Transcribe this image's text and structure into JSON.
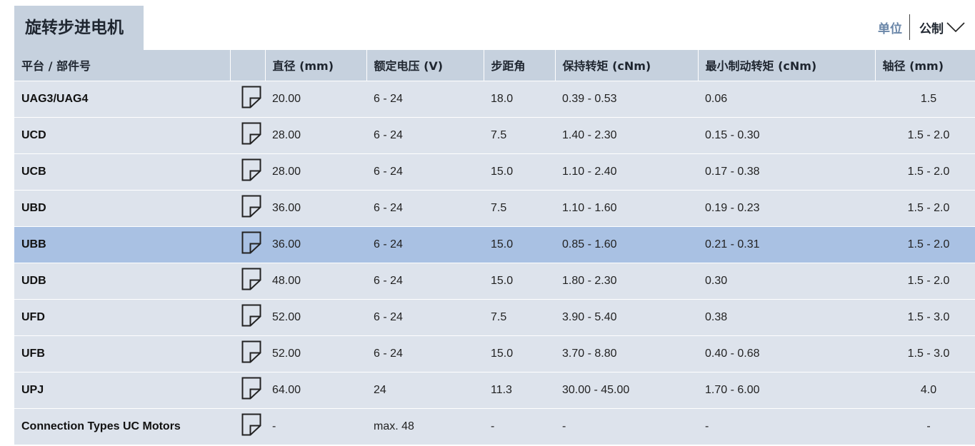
{
  "header": {
    "title": "旋转步进电机",
    "units_label": "单位",
    "units_value": "公制"
  },
  "table": {
    "columns": [
      "平台 / 部件号",
      "",
      "直径 (mm)",
      "额定电压 (V)",
      "步距角",
      "保持转矩 (cNm)",
      "最小制动转矩 (cNm)",
      "轴径 (mm)"
    ],
    "rows": [
      {
        "part": "UAG3/UAG4",
        "diameter": "20.00",
        "voltage": "6 - 24",
        "step_angle": "18.0",
        "holding_torque": "0.39 - 0.53",
        "detent_torque": "0.06",
        "shaft": "1.5"
      },
      {
        "part": "UCD",
        "diameter": "28.00",
        "voltage": "6 - 24",
        "step_angle": "7.5",
        "holding_torque": "1.40 - 2.30",
        "detent_torque": "0.15 - 0.30",
        "shaft": "1.5 - 2.0"
      },
      {
        "part": "UCB",
        "diameter": "28.00",
        "voltage": "6 - 24",
        "step_angle": "15.0",
        "holding_torque": "1.10 - 2.40",
        "detent_torque": "0.17 - 0.38",
        "shaft": "1.5 - 2.0"
      },
      {
        "part": "UBD",
        "diameter": "36.00",
        "voltage": "6 - 24",
        "step_angle": "7.5",
        "holding_torque": "1.10 - 1.60",
        "detent_torque": "0.19 - 0.23",
        "shaft": "1.5 - 2.0"
      },
      {
        "part": "UBB",
        "diameter": "36.00",
        "voltage": "6 - 24",
        "step_angle": "15.0",
        "holding_torque": "0.85 - 1.60",
        "detent_torque": "0.21 - 0.31",
        "shaft": "1.5 - 2.0",
        "selected": true
      },
      {
        "part": "UDB",
        "diameter": "48.00",
        "voltage": "6 - 24",
        "step_angle": "15.0",
        "holding_torque": "1.80 - 2.30",
        "detent_torque": "0.30",
        "shaft": "1.5 - 2.0"
      },
      {
        "part": "UFD",
        "diameter": "52.00",
        "voltage": "6 - 24",
        "step_angle": "7.5",
        "holding_torque": "3.90 - 5.40",
        "detent_torque": "0.38",
        "shaft": "1.5 - 3.0"
      },
      {
        "part": "UFB",
        "diameter": "52.00",
        "voltage": "6 - 24",
        "step_angle": "15.0",
        "holding_torque": "3.70 - 8.80",
        "detent_torque": "0.40 - 0.68",
        "shaft": "1.5 - 3.0"
      },
      {
        "part": "UPJ",
        "diameter": "64.00",
        "voltage": "24",
        "step_angle": "11.3",
        "holding_torque": "30.00 - 45.00",
        "detent_torque": "1.70 - 6.00",
        "shaft": "4.0"
      },
      {
        "part": "Connection Types UC Motors",
        "diameter": "-",
        "voltage": "max. 48",
        "step_angle": "-",
        "holding_torque": "-",
        "detent_torque": "-",
        "shaft": "-"
      }
    ]
  },
  "icons": {
    "row_action": "document-icon",
    "units_toggle": "chevron-down-icon"
  },
  "colors": {
    "header_bg": "#c6d1de",
    "row_bg": "#dde3ec",
    "row_selected_bg": "#a9c1e3",
    "units_label": "#6a86a8"
  }
}
